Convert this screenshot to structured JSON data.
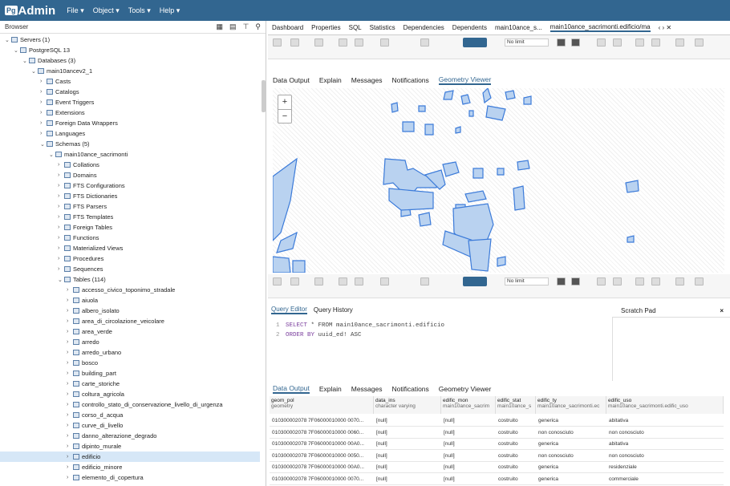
{
  "app": {
    "name": "Admin",
    "logo_prefix": "Pg"
  },
  "menus": [
    "File ▾",
    "Object ▾",
    "Tools ▾",
    "Help ▾"
  ],
  "browser": {
    "title": "Browser"
  },
  "tree": [
    {
      "label": "Servers (1)",
      "indent": 0,
      "arrow": "⌄"
    },
    {
      "label": "PostgreSQL 13",
      "indent": 1,
      "arrow": "⌄"
    },
    {
      "label": "Databases (3)",
      "indent": 2,
      "arrow": "⌄"
    },
    {
      "label": "main10ancev2_1",
      "indent": 3,
      "arrow": "⌄"
    },
    {
      "label": "Casts",
      "indent": 4,
      "arrow": "›"
    },
    {
      "label": "Catalogs",
      "indent": 4,
      "arrow": "›"
    },
    {
      "label": "Event Triggers",
      "indent": 4,
      "arrow": "›"
    },
    {
      "label": "Extensions",
      "indent": 4,
      "arrow": "›"
    },
    {
      "label": "Foreign Data Wrappers",
      "indent": 4,
      "arrow": "›"
    },
    {
      "label": "Languages",
      "indent": 4,
      "arrow": "›"
    },
    {
      "label": "Schemas (5)",
      "indent": 4,
      "arrow": "⌄"
    },
    {
      "label": "main10ance_sacrimonti",
      "indent": 5,
      "arrow": "⌄"
    },
    {
      "label": "Collations",
      "indent": 6,
      "arrow": "›"
    },
    {
      "label": "Domains",
      "indent": 6,
      "arrow": "›"
    },
    {
      "label": "FTS Configurations",
      "indent": 6,
      "arrow": "›"
    },
    {
      "label": "FTS Dictionaries",
      "indent": 6,
      "arrow": "›"
    },
    {
      "label": "FTS Parsers",
      "indent": 6,
      "arrow": "›"
    },
    {
      "label": "FTS Templates",
      "indent": 6,
      "arrow": "›"
    },
    {
      "label": "Foreign Tables",
      "indent": 6,
      "arrow": "›"
    },
    {
      "label": "Functions",
      "indent": 6,
      "arrow": "›"
    },
    {
      "label": "Materialized Views",
      "indent": 6,
      "arrow": "›"
    },
    {
      "label": "Procedures",
      "indent": 6,
      "arrow": "›"
    },
    {
      "label": "Sequences",
      "indent": 6,
      "arrow": "›"
    },
    {
      "label": "Tables (114)",
      "indent": 6,
      "arrow": "⌄"
    },
    {
      "label": "accesso_civico_toponimo_stradale",
      "indent": 7,
      "arrow": "›"
    },
    {
      "label": "aiuola",
      "indent": 7,
      "arrow": "›"
    },
    {
      "label": "albero_isolato",
      "indent": 7,
      "arrow": "›"
    },
    {
      "label": "area_di_circolazione_veicolare",
      "indent": 7,
      "arrow": "›"
    },
    {
      "label": "area_verde",
      "indent": 7,
      "arrow": "›"
    },
    {
      "label": "arredo",
      "indent": 7,
      "arrow": "›"
    },
    {
      "label": "arredo_urbano",
      "indent": 7,
      "arrow": "›"
    },
    {
      "label": "bosco",
      "indent": 7,
      "arrow": "›"
    },
    {
      "label": "building_part",
      "indent": 7,
      "arrow": "›"
    },
    {
      "label": "carte_storiche",
      "indent": 7,
      "arrow": "›"
    },
    {
      "label": "coltura_agricola",
      "indent": 7,
      "arrow": "›"
    },
    {
      "label": "controllo_stato_di_conservazione_livello_di_urgenza",
      "indent": 7,
      "arrow": "›"
    },
    {
      "label": "corso_d_acqua",
      "indent": 7,
      "arrow": "›"
    },
    {
      "label": "curve_di_livello",
      "indent": 7,
      "arrow": "›"
    },
    {
      "label": "danno_alterazione_degrado",
      "indent": 7,
      "arrow": "›"
    },
    {
      "label": "dipinto_murale",
      "indent": 7,
      "arrow": "›"
    },
    {
      "label": "edificio",
      "indent": 7,
      "arrow": "›",
      "selected": true
    },
    {
      "label": "edificio_minore",
      "indent": 7,
      "arrow": "›"
    },
    {
      "label": "elemento_di_copertura",
      "indent": 7,
      "arrow": "›"
    }
  ],
  "tabs": [
    "Dashboard",
    "Properties",
    "SQL",
    "Statistics",
    "Dependencies",
    "Dependents",
    "main10ance_s...",
    "main10ance_sacrimonti.edificio/ma"
  ],
  "top_result_tabs": [
    "Data Output",
    "Explain",
    "Messages",
    "Notifications",
    "Geometry Viewer"
  ],
  "toolbar": {
    "no_limit": "No limit"
  },
  "zoom": {
    "plus": "+",
    "minus": "−"
  },
  "query_tabs": [
    "Query Editor",
    "Query History"
  ],
  "scratch_pad": "Scratch Pad",
  "scratch_close": "×",
  "sql": [
    {
      "ln": "1",
      "kw": "SELECT",
      "rest": " * FROM main10ance_sacrimonti.edificio"
    },
    {
      "ln": "2",
      "kw": "ORDER BY",
      "rest": " uuid_ed! ASC"
    }
  ],
  "bottom_result_tabs": [
    "Data Output",
    "Explain",
    "Messages",
    "Notifications",
    "Geometry Viewer"
  ],
  "grid": {
    "headers": [
      {
        "name": "geom_pol",
        "type": "geometry"
      },
      {
        "name": "data_ins",
        "type": "character varying"
      },
      {
        "name": "edific_mon",
        "type": "main10ance_sacrim"
      },
      {
        "name": "edific_stat",
        "type": "main10ance_s"
      },
      {
        "name": "edific_ty",
        "type": "main10ance_sacrimonti.ec"
      },
      {
        "name": "edific_uso",
        "type": "main10ance_sacrimonti.edific_uso"
      }
    ],
    "rows": [
      [
        "010300002078 7F06000010000 0070...",
        "[null]",
        "[null]",
        "costruito",
        "generica",
        "abitativa"
      ],
      [
        "010300002078 7F06000010000 0060...",
        "[null]",
        "[null]",
        "costruito",
        "non conosciuto",
        "non conosciuto"
      ],
      [
        "010300002078 7F06000010000 00A0...",
        "[null]",
        "[null]",
        "costruito",
        "generica",
        "abitativa"
      ],
      [
        "010300002078 7F06000010000 0050...",
        "[null]",
        "[null]",
        "costruito",
        "non conosciuto",
        "non conosciuto"
      ],
      [
        "010300002078 7F06000010000 00A0...",
        "[null]",
        "[null]",
        "costruito",
        "generica",
        "residenziale"
      ],
      [
        "010300002078 7F06000010000 0070...",
        "[null]",
        "[null]",
        "costruito",
        "generica",
        "commerciale"
      ]
    ]
  }
}
